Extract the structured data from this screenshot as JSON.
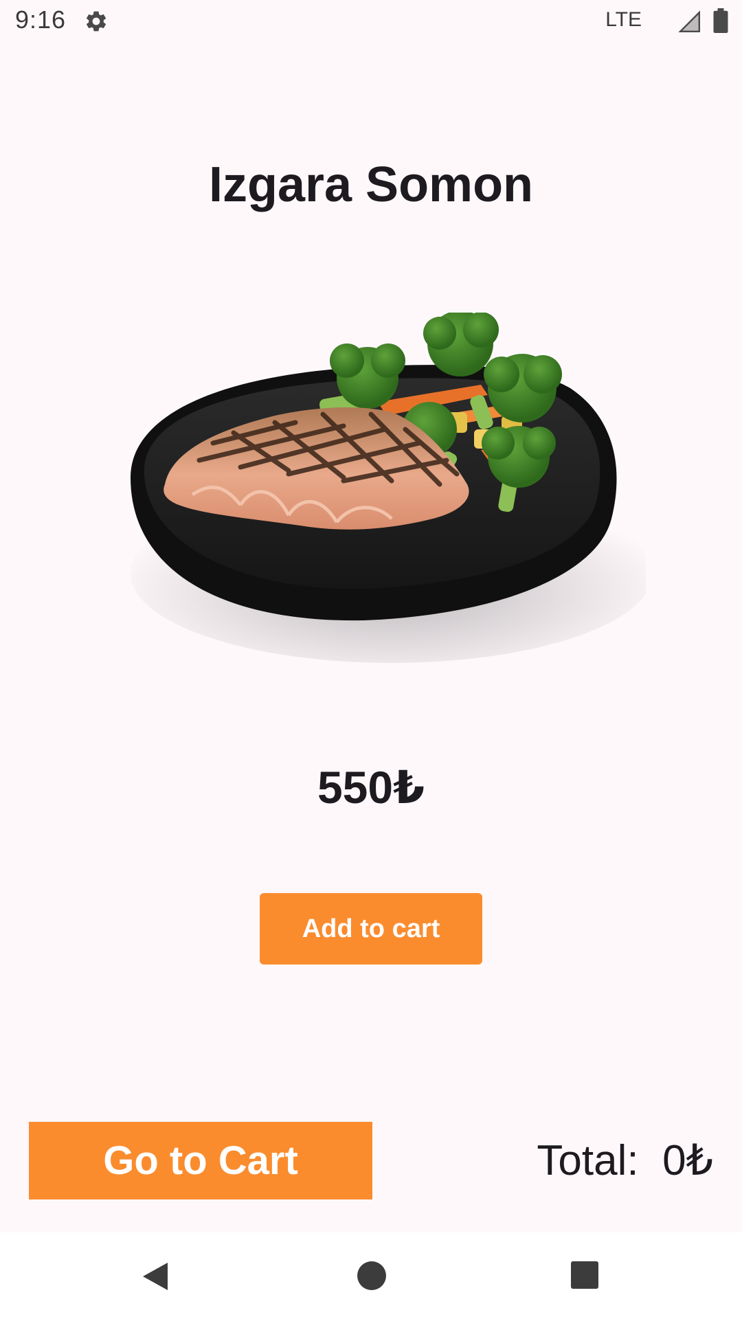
{
  "status_bar": {
    "time": "9:16",
    "settings_icon": "gear-icon",
    "network": "LTE",
    "signal_icon": "signal-icon",
    "battery_icon": "battery-icon"
  },
  "product": {
    "title": "Izgara Somon",
    "image": "grilled-salmon-plate",
    "price": "550₺",
    "add_to_cart_label": "Add to cart"
  },
  "footer": {
    "go_to_cart_label": "Go to Cart",
    "total_label": "Total:",
    "total_value": "0₺"
  },
  "nav_bar": {
    "back_icon": "back-triangle-icon",
    "home_icon": "home-circle-icon",
    "recents_icon": "recents-square-icon"
  },
  "colors": {
    "accent": "#fa8c2e",
    "background": "#fef8fb",
    "text": "#1d1b20"
  }
}
